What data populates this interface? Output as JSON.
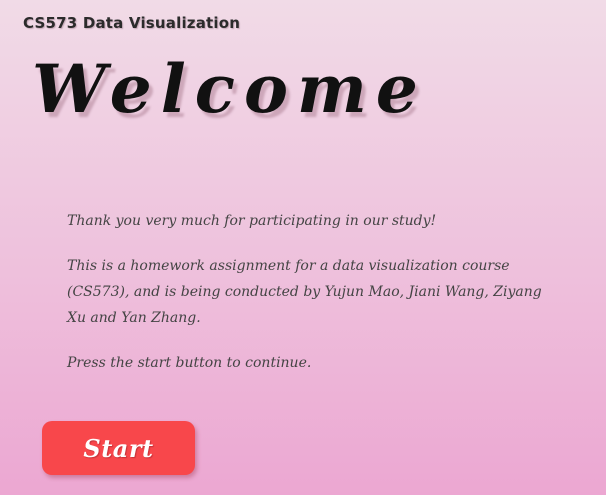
{
  "header": {
    "app_title": "CS573 Data Visualization"
  },
  "main": {
    "heading": "Welcome",
    "paragraphs": [
      "Thank you very much for participating in our study!",
      "This is a homework assignment for a data visualization course (CS573), and is being conducted by Yujun Mao, Jiani Wang, Ziyang Xu and Yan Zhang.",
      "Press the start button to continue."
    ],
    "start_label": "Start"
  },
  "colors": {
    "background_top": "#f1dbe7",
    "background_bottom": "#eca7d2",
    "start_button": "#f8474b"
  }
}
